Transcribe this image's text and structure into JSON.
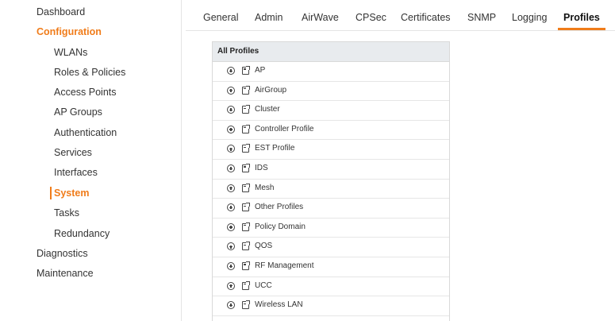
{
  "colors": {
    "accent": "#f07c1a",
    "panel_header_bg": "#e8ebee"
  },
  "sidebar": {
    "top": [
      {
        "id": "dashboard",
        "label": "Dashboard"
      },
      {
        "id": "configuration",
        "label": "Configuration",
        "active": true
      }
    ],
    "sub": [
      {
        "id": "wlans",
        "label": "WLANs"
      },
      {
        "id": "roles-policies",
        "label": "Roles & Policies"
      },
      {
        "id": "access-points",
        "label": "Access Points"
      },
      {
        "id": "ap-groups",
        "label": "AP Groups"
      },
      {
        "id": "authentication",
        "label": "Authentication"
      },
      {
        "id": "services",
        "label": "Services"
      },
      {
        "id": "interfaces",
        "label": "Interfaces"
      },
      {
        "id": "system",
        "label": "System",
        "active": true
      },
      {
        "id": "tasks",
        "label": "Tasks"
      },
      {
        "id": "redundancy",
        "label": "Redundancy"
      }
    ],
    "bottom": [
      {
        "id": "diagnostics",
        "label": "Diagnostics"
      },
      {
        "id": "maintenance",
        "label": "Maintenance"
      }
    ]
  },
  "tabs": [
    {
      "id": "general",
      "label": "General"
    },
    {
      "id": "admin",
      "label": "Admin"
    },
    {
      "id": "airwave",
      "label": "AirWave"
    },
    {
      "id": "cpsec",
      "label": "CPSec"
    },
    {
      "id": "certificates",
      "label": "Certificates"
    },
    {
      "id": "snmp",
      "label": "SNMP"
    },
    {
      "id": "logging",
      "label": "Logging"
    },
    {
      "id": "profiles",
      "label": "Profiles",
      "active": true
    }
  ],
  "profiles": {
    "header": "All Profiles",
    "items": [
      "AP",
      "AirGroup",
      "Cluster",
      "Controller Profile",
      "EST Profile",
      "IDS",
      "Mesh",
      "Other Profiles",
      "Policy Domain",
      "QOS",
      "RF Management",
      "UCC",
      "Wireless LAN"
    ]
  }
}
